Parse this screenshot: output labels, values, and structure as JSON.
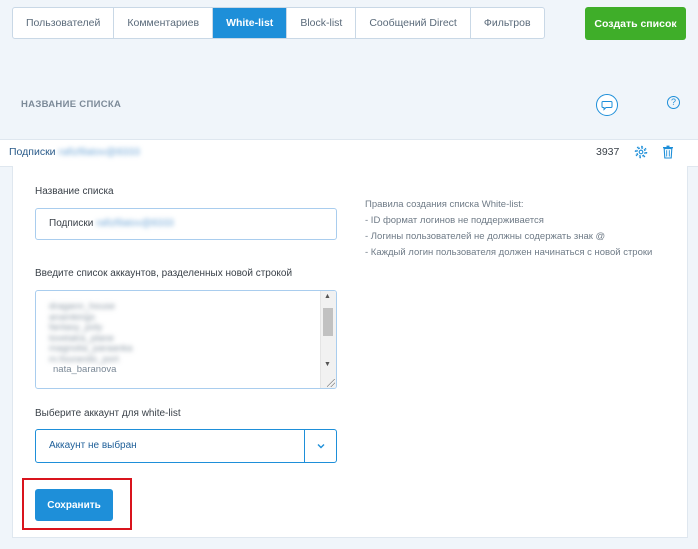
{
  "tabs": [
    {
      "label": "Пользователей",
      "active": false
    },
    {
      "label": "Комментариев",
      "active": false
    },
    {
      "label": "White-list",
      "active": true
    },
    {
      "label": "Block-list",
      "active": false
    },
    {
      "label": "Сообщений Direct",
      "active": false
    },
    {
      "label": "Фильтров",
      "active": false
    }
  ],
  "header": {
    "create_button": "Создать список",
    "section_title": "НАЗВАНИЕ СПИСКА",
    "help_symbol": "?"
  },
  "list_row": {
    "name_prefix": "Подписки",
    "name_blurred": "rafizfilatov@8333",
    "count": "3937"
  },
  "form": {
    "name_label": "Название списка",
    "name_value_prefix": "Подписки",
    "name_value_blurred": "rafizfilatov@8333",
    "accounts_label": "Введите список аккаунтов, разделенных новой строкой",
    "accounts_lines_blurred": [
      "dragann_house",
      "anamkings",
      "fantasy_poly",
      "lovetatra_plane",
      "magnolia_paraanka",
      "m.fourando_port"
    ],
    "accounts_last_line": "nata_baranova",
    "account_select_label": "Выберите аккаунт для white-list",
    "account_select_value": "Аккаунт не выбран",
    "save_button": "Сохранить"
  },
  "rules": {
    "title": "Правила создания списка White-list:",
    "items": [
      "- ID формат логинов не поддерживается",
      "- Логины пользователей не должны содержать знак @",
      "- Каждый логин пользователя должен начинаться с новой строки"
    ]
  },
  "colors": {
    "accent": "#1e8fd9",
    "create_green": "#3fae29",
    "highlight_red": "#d9141d",
    "background": "#f0f5fa"
  }
}
